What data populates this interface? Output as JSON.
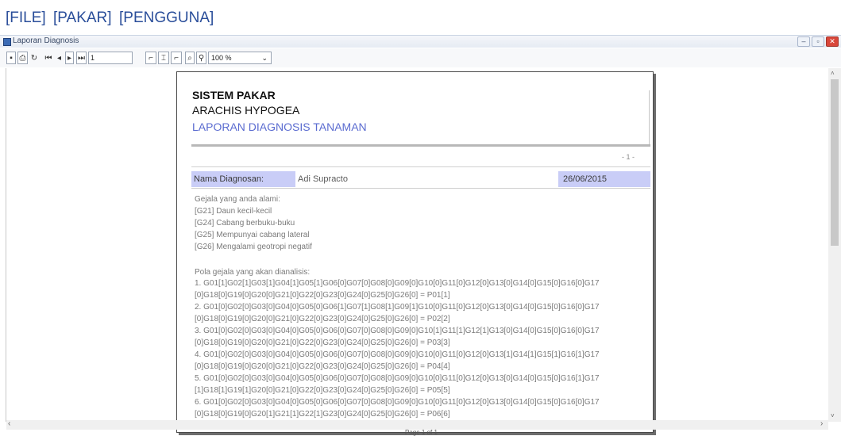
{
  "menu": {
    "file": "[FILE]",
    "pakar": "[PAKAR]",
    "pengguna": "[PENGGUNA]"
  },
  "window": {
    "title": "Laporan Diagnosis",
    "minimize_icon": "minimize-icon",
    "restore_icon": "restore-icon",
    "close_icon": "close-icon"
  },
  "toolbar": {
    "page_number": "1",
    "zoom_value": "100 %",
    "icons": [
      "save-icon",
      "print-icon",
      "refresh-icon",
      "first-page-icon",
      "prev-page-icon",
      "next-page-icon",
      "last-page-icon",
      "toggle-tree-icon",
      "export-icon",
      "page-setup-icon",
      "search-icon",
      "zoom-icon"
    ]
  },
  "report": {
    "title": "SISTEM PAKAR",
    "subtitle": "ARACHIS HYPOGEA",
    "subtitle2": "LAPORAN DIAGNOSIS TANAMAN",
    "page_marker": "- 1 -",
    "name_label": "Nama Diagnosan:",
    "name_value": "Adi Supracto",
    "date": "26/06/2015",
    "accent_color": "#c9cdf7",
    "symptoms_heading": "Gejala yang anda alami:",
    "symptoms": [
      "[G21] Daun kecil-kecil",
      "[G24] Cabang berbuku-buku",
      "[G25] Mempunyai cabang lateral",
      "[G26] Mengalami geotropi negatif"
    ],
    "patterns_heading": "Pola gejala yang akan dianalisis:",
    "patterns": [
      "1. G01[1]G02[1]G03[1]G04[1]G05[1]G06[0]G07[0]G08[0]G09[0]G10[0]G11[0]G12[0]G13[0]G14[0]G15[0]G16[0]G17",
      "[0]G18[0]G19[0]G20[0]G21[0]G22[0]G23[0]G24[0]G25[0]G26[0] = P01[1]",
      "2. G01[0]G02[0]G03[0]G04[0]G05[0]G06[1]G07[1]G08[1]G09[1]G10[0]G11[0]G12[0]G13[0]G14[0]G15[0]G16[0]G17",
      "[0]G18[0]G19[0]G20[0]G21[0]G22[0]G23[0]G24[0]G25[0]G26[0] = P02[2]",
      "3. G01[0]G02[0]G03[0]G04[0]G05[0]G06[0]G07[0]G08[0]G09[0]G10[1]G11[1]G12[1]G13[0]G14[0]G15[0]G16[0]G17",
      "[0]G18[0]G19[0]G20[0]G21[0]G22[0]G23[0]G24[0]G25[0]G26[0] = P03[3]",
      "4. G01[0]G02[0]G03[0]G04[0]G05[0]G06[0]G07[0]G08[0]G09[0]G10[0]G11[0]G12[0]G13[1]G14[1]G15[1]G16[1]G17",
      "[0]G18[0]G19[0]G20[0]G21[0]G22[0]G23[0]G24[0]G25[0]G26[0] = P04[4]",
      "5. G01[0]G02[0]G03[0]G04[0]G05[0]G06[0]G07[0]G08[0]G09[0]G10[0]G11[0]G12[0]G13[0]G14[0]G15[0]G16[1]G17",
      "[1]G18[1]G19[1]G20[0]G21[0]G22[0]G23[0]G24[0]G25[0]G26[0] = P05[5]",
      "6. G01[0]G02[0]G03[0]G04[0]G05[0]G06[0]G07[0]G08[0]G09[0]G10[0]G11[0]G12[0]G13[0]G14[0]G15[0]G16[0]G17",
      "[0]G18[0]G19[0]G20[1]G21[1]G22[1]G23[0]G24[0]G25[0]G26[0] = P06[6]"
    ]
  },
  "status": {
    "text": "Page 1 of 1"
  }
}
